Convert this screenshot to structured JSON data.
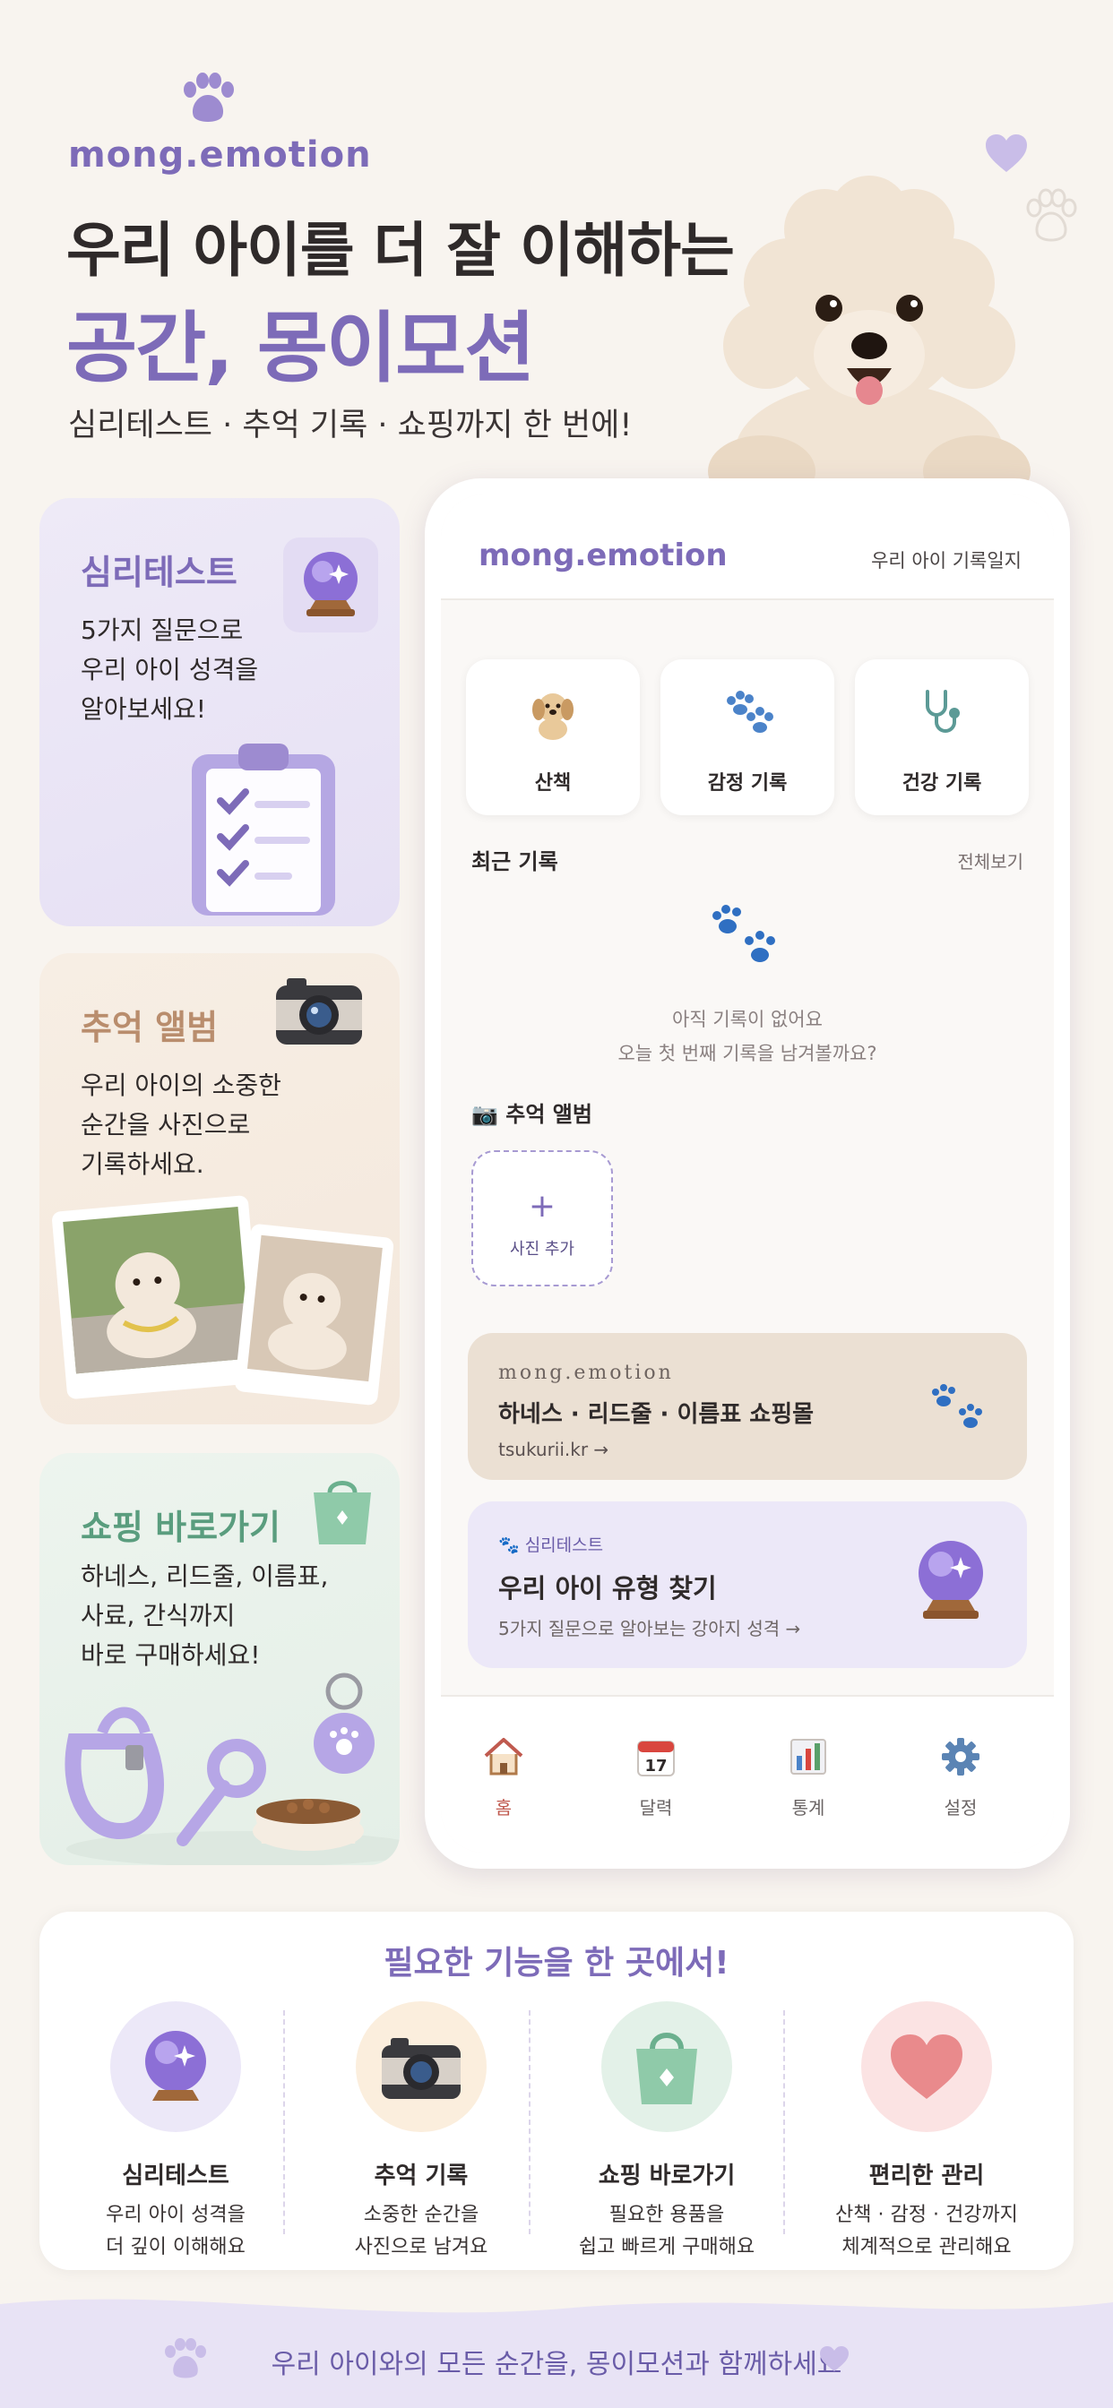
{
  "brand": "mong.emotion",
  "hero": {
    "line1": "우리 아이를 더 잘 이해하는",
    "line2": "공간, 몽이모션",
    "subtitle": "심리테스트 · 추억 기록 · 쇼핑까지 한 번에!"
  },
  "cards": [
    {
      "title": "심리테스트",
      "lines": [
        "5가지 질문으로",
        "우리 아이 성격을",
        "알아보세요!"
      ]
    },
    {
      "title": "추억 앨범",
      "lines": [
        "우리 아이의 소중한",
        "순간을 사진으로",
        "기록하세요."
      ]
    },
    {
      "title": "쇼핑 바로가기",
      "lines": [
        "하네스, 리드줄, 이름표,",
        "사료, 간식까지",
        "바로 구매하세요!"
      ]
    }
  ],
  "phone": {
    "brand": "mong.emotion",
    "header_right": "우리 아이 기록일지",
    "quick_actions": [
      {
        "label": "산책",
        "icon": "dog-icon"
      },
      {
        "label": "감정 기록",
        "icon": "paw-icon"
      },
      {
        "label": "건강 기록",
        "icon": "stethoscope-icon"
      }
    ],
    "recent": {
      "title": "최근 기록",
      "see_all": "전체보기",
      "empty_line1": "아직 기록이 없어요",
      "empty_line2": "오늘 첫 번째 기록을 남겨볼까요?"
    },
    "album": {
      "title": "📷 추억 앨범",
      "plus": "+",
      "add_label": "사진 추가"
    },
    "shop_banner": {
      "brand": "mong.emotion",
      "title": "하네스 · 리드줄 · 이름표 쇼핑몰",
      "link": "tsukurii.kr →"
    },
    "test_banner": {
      "tag": "🐾 심리테스트",
      "title": "우리 아이 유형 찾기",
      "desc": "5가지 질문으로 알아보는 강아지 성격 →"
    },
    "tabs": [
      {
        "label": "홈",
        "icon": "home-icon",
        "active": true
      },
      {
        "label": "달력",
        "icon": "calendar-icon",
        "date": "17"
      },
      {
        "label": "통계",
        "icon": "chart-icon"
      },
      {
        "label": "설정",
        "icon": "gear-icon"
      }
    ]
  },
  "features": {
    "title": "필요한 기능을 한 곳에서!",
    "items": [
      {
        "name": "심리테스트",
        "desc": [
          "우리 아이 성격을",
          "더 깊이 이해해요"
        ],
        "icon": "crystal-ball-icon",
        "bg": "#ece8f8"
      },
      {
        "name": "추억 기록",
        "desc": [
          "소중한 순간을",
          "사진으로 남겨요"
        ],
        "icon": "camera-icon",
        "bg": "#fbeedd"
      },
      {
        "name": "쇼핑 바로가기",
        "desc": [
          "필요한 용품을",
          "쉽고 빠르게 구매해요"
        ],
        "icon": "shopping-bag-icon",
        "bg": "#e3f1e8"
      },
      {
        "name": "편리한 관리",
        "desc": [
          "산책 · 감정 · 건강까지",
          "체계적으로 관리해요"
        ],
        "icon": "heart-icon",
        "bg": "#fbe3e3"
      }
    ]
  },
  "footer": {
    "text": "우리 아이와의 모든 순간을, 몽이모션과 함께하세요"
  },
  "colors": {
    "accent": "#7d6bb8",
    "background": "#f8f4ef",
    "memory": "#b98d6d",
    "shopping": "#5a9d7e"
  }
}
